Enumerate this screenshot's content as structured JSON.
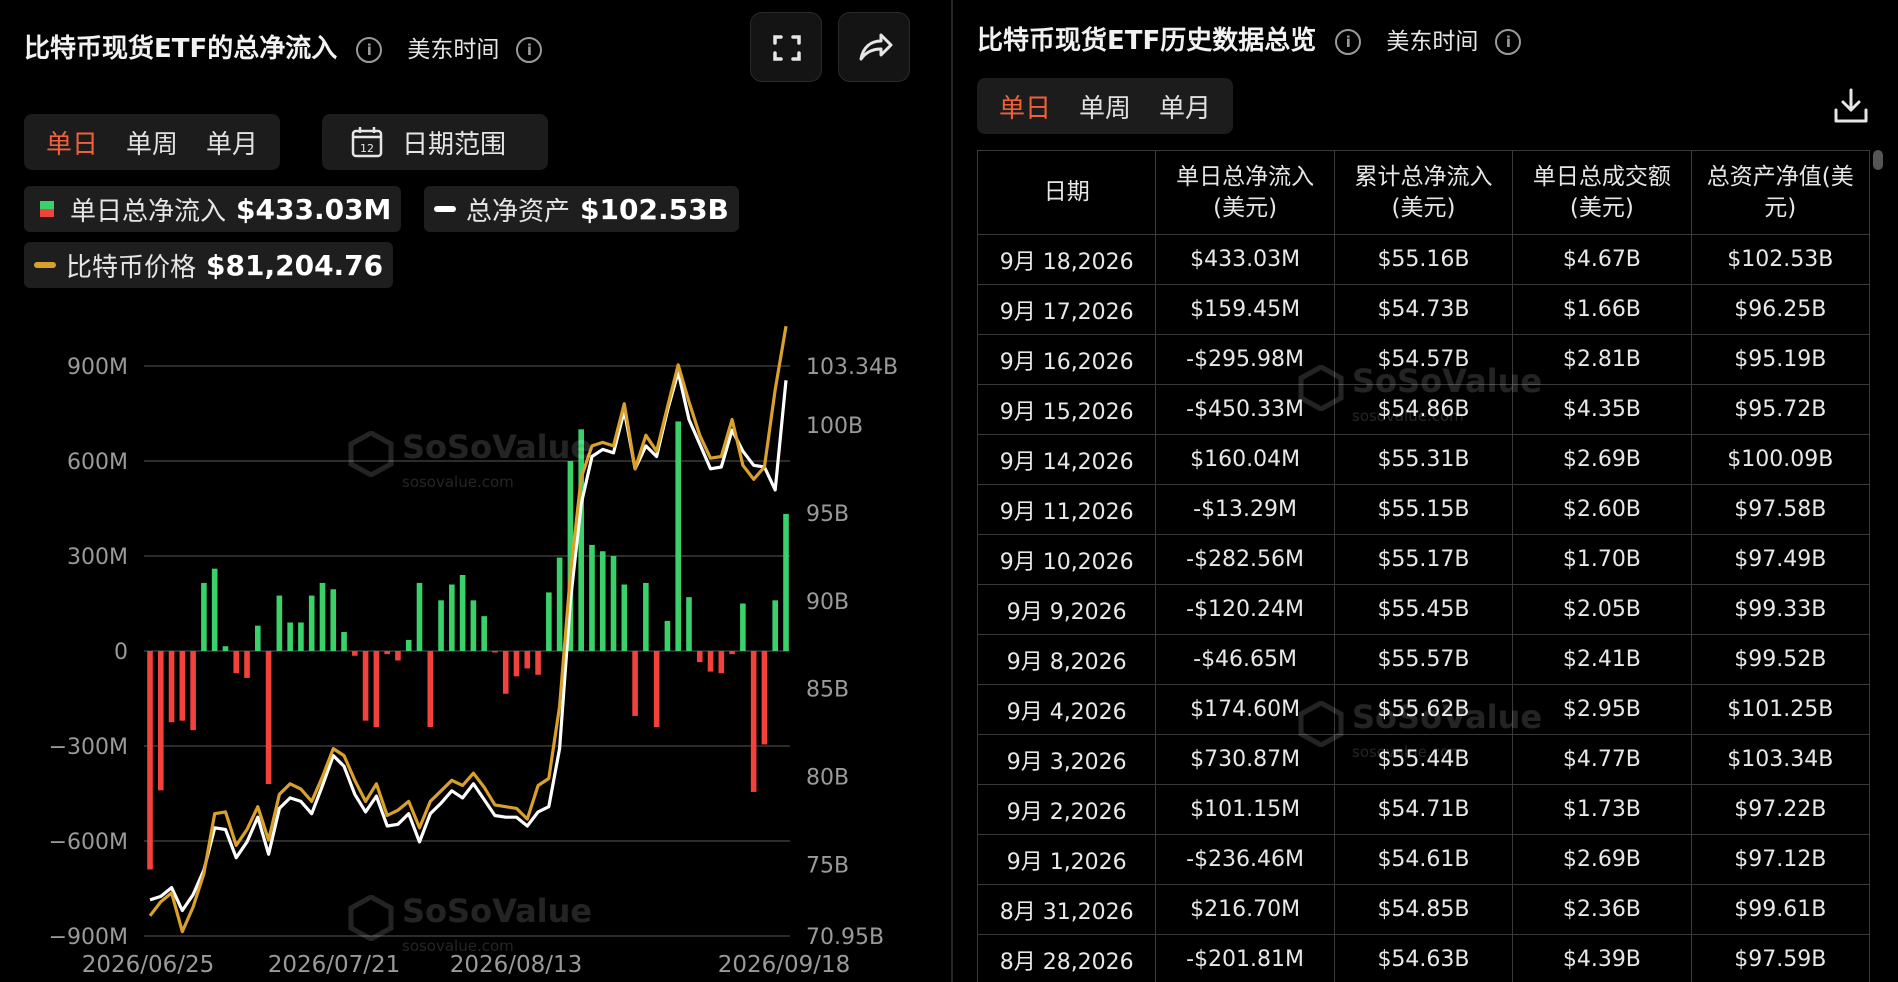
{
  "left": {
    "title": "比特币现货ETF的总净流入",
    "timezone": "美东时间",
    "tabs": [
      {
        "label": "单日",
        "active": true
      },
      {
        "label": "单周",
        "active": false
      },
      {
        "label": "单月",
        "active": false
      }
    ],
    "date_range_label": "日期范围",
    "calendar_day": "12",
    "legend": {
      "net_inflow": {
        "label": "单日总净流入",
        "value": "$433.03M"
      },
      "total_assets": {
        "label": "总净资产",
        "value": "$102.53B"
      },
      "btc_price": {
        "label": "比特币价格",
        "value": "$81,204.76"
      }
    },
    "watermark": {
      "name": "SoSoValue",
      "sub": "sosovalue.com"
    }
  },
  "chart_data": {
    "type": "bar",
    "left_axis": {
      "ticks": [
        "900M",
        "600M",
        "300M",
        "0",
        "−300M",
        "−600M",
        "−900M"
      ],
      "min": -900,
      "max": 900,
      "unit": "M"
    },
    "right_axis": {
      "ticks": [
        "103.34B",
        "100B",
        "95B",
        "90B",
        "85B",
        "80B",
        "75B",
        "70.95B"
      ],
      "min": 70.95,
      "max": 103.34,
      "unit": "B"
    },
    "x_ticks": [
      "2026/06/25",
      "2026/07/21",
      "2026/08/13",
      "2026/09/18"
    ],
    "grid": true,
    "colors": {
      "positive": "#3bd16a",
      "negative": "#f2423c",
      "assets": "#ffffff",
      "price": "#d9a02c"
    },
    "series": [
      {
        "name": "单日总净流入",
        "values": [
          -690,
          -440,
          -225,
          -220,
          -250,
          215,
          260,
          15,
          -70,
          -85,
          80,
          -420,
          175,
          90,
          90,
          175,
          215,
          195,
          60,
          -15,
          -220,
          -240,
          -10,
          -30,
          35,
          215,
          -240,
          160,
          210,
          240,
          160,
          110,
          -3,
          -135,
          -80,
          -55,
          -75,
          185,
          295,
          600,
          700,
          335,
          315,
          300,
          210,
          -205,
          215,
          -240,
          95,
          725,
          170,
          -35,
          -65,
          -70,
          -10,
          150,
          -445,
          -295,
          160,
          433
        ]
      },
      {
        "name": "总净资产",
        "values": [
          73.0,
          73.2,
          73.7,
          72.4,
          73.3,
          74.7,
          77.1,
          77.0,
          75.4,
          76.3,
          77.7,
          75.6,
          78.2,
          78.8,
          78.6,
          77.9,
          79.5,
          81.2,
          80.6,
          79.0,
          78.0,
          78.9,
          77.2,
          77.3,
          77.9,
          76.3,
          77.9,
          78.5,
          79.2,
          78.8,
          79.6,
          78.7,
          77.8,
          77.7,
          77.7,
          77.2,
          78.0,
          78.3,
          81.6,
          90.0,
          95.5,
          98.2,
          98.6,
          98.4,
          100.8,
          97.5,
          98.8,
          98.2,
          100.8,
          103.0,
          100.3,
          98.9,
          97.5,
          97.6,
          99.7,
          98.5,
          97.7,
          97.6,
          96.3,
          102.53
        ]
      },
      {
        "name": "比特币价格",
        "values": [
          72.1,
          72.9,
          73.4,
          71.2,
          72.6,
          74.5,
          77.9,
          78.0,
          76.1,
          77.0,
          78.3,
          76.4,
          79.0,
          79.6,
          79.3,
          78.6,
          80.0,
          81.6,
          81.2,
          79.8,
          78.6,
          79.6,
          77.8,
          78.1,
          78.6,
          77.1,
          78.6,
          79.2,
          79.8,
          79.5,
          80.2,
          79.4,
          78.4,
          78.3,
          78.2,
          77.6,
          79.5,
          79.9,
          84.0,
          91.5,
          97.0,
          98.8,
          99.0,
          98.8,
          101.2,
          97.5,
          99.4,
          98.5,
          101.0,
          103.4,
          101.3,
          99.4,
          98.1,
          98.2,
          100.3,
          97.7,
          96.9,
          97.6,
          102.0,
          105.6
        ]
      }
    ]
  },
  "right": {
    "title": "比特币现货ETF历史数据总览",
    "timezone": "美东时间",
    "tabs": [
      {
        "label": "单日",
        "active": true
      },
      {
        "label": "单周",
        "active": false
      },
      {
        "label": "单月",
        "active": false
      }
    ],
    "columns": [
      [
        "日期"
      ],
      [
        "单日总净流入",
        "(美元)"
      ],
      [
        "累计总净流入",
        "(美元)"
      ],
      [
        "单日总成交额",
        "(美元)"
      ],
      [
        "总资产净值(美",
        "元)"
      ]
    ],
    "rows": [
      {
        "date": "9月 18,2026",
        "net": "$433.03M",
        "sign": "pos",
        "cum": "$55.16B",
        "vol": "$4.67B",
        "nav": "$102.53B"
      },
      {
        "date": "9月 17,2026",
        "net": "$159.45M",
        "sign": "pos",
        "cum": "$54.73B",
        "vol": "$1.66B",
        "nav": "$96.25B"
      },
      {
        "date": "9月 16,2026",
        "net": "-$295.98M",
        "sign": "neg",
        "cum": "$54.57B",
        "vol": "$2.81B",
        "nav": "$95.19B"
      },
      {
        "date": "9月 15,2026",
        "net": "-$450.33M",
        "sign": "neg",
        "cum": "$54.86B",
        "vol": "$4.35B",
        "nav": "$95.72B"
      },
      {
        "date": "9月 14,2026",
        "net": "$160.04M",
        "sign": "pos",
        "cum": "$55.31B",
        "vol": "$2.69B",
        "nav": "$100.09B"
      },
      {
        "date": "9月 11,2026",
        "net": "-$13.29M",
        "sign": "neg",
        "cum": "$55.15B",
        "vol": "$2.60B",
        "nav": "$97.58B"
      },
      {
        "date": "9月 10,2026",
        "net": "-$282.56M",
        "sign": "neg",
        "cum": "$55.17B",
        "vol": "$1.70B",
        "nav": "$97.49B"
      },
      {
        "date": "9月 9,2026",
        "net": "-$120.24M",
        "sign": "neg",
        "cum": "$55.45B",
        "vol": "$2.05B",
        "nav": "$99.33B"
      },
      {
        "date": "9月 8,2026",
        "net": "-$46.65M",
        "sign": "neg",
        "cum": "$55.57B",
        "vol": "$2.41B",
        "nav": "$99.52B"
      },
      {
        "date": "9月 4,2026",
        "net": "$174.60M",
        "sign": "pos",
        "cum": "$55.62B",
        "vol": "$2.95B",
        "nav": "$101.25B"
      },
      {
        "date": "9月 3,2026",
        "net": "$730.87M",
        "sign": "pos",
        "cum": "$55.44B",
        "vol": "$4.77B",
        "nav": "$103.34B"
      },
      {
        "date": "9月 2,2026",
        "net": "$101.15M",
        "sign": "pos",
        "cum": "$54.71B",
        "vol": "$1.73B",
        "nav": "$97.22B"
      },
      {
        "date": "9月 1,2026",
        "net": "-$236.46M",
        "sign": "neg",
        "cum": "$54.61B",
        "vol": "$2.69B",
        "nav": "$97.12B"
      },
      {
        "date": "8月 31,2026",
        "net": "$216.70M",
        "sign": "pos",
        "cum": "$54.85B",
        "vol": "$2.36B",
        "nav": "$99.61B"
      },
      {
        "date": "8月 28,2026",
        "net": "-$201.81M",
        "sign": "neg",
        "cum": "$54.63B",
        "vol": "$4.39B",
        "nav": "$97.59B"
      }
    ]
  }
}
